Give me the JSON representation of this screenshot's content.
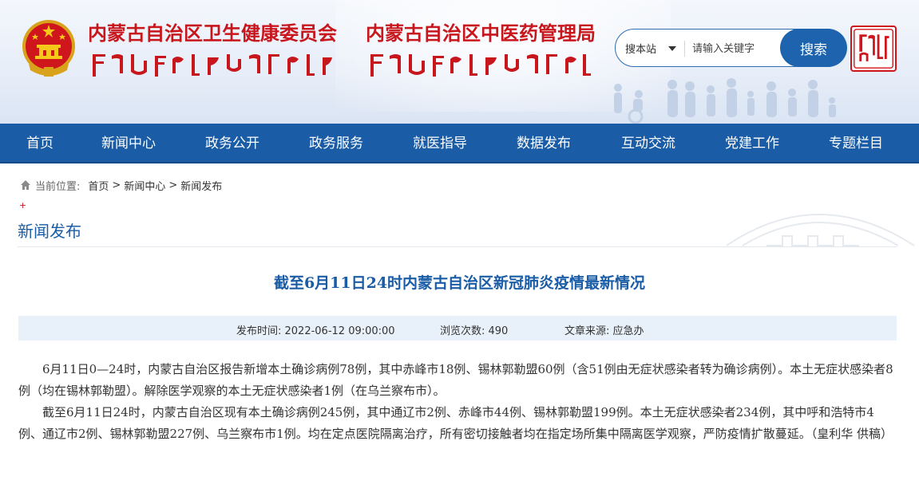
{
  "header": {
    "org1": "内蒙古自治区卫生健康委员会",
    "org2": "内蒙古自治区中医药管理局",
    "search": {
      "site_label": "搜本站",
      "placeholder": "请输入关键字",
      "button_label": "搜索"
    }
  },
  "nav": {
    "items": [
      "首页",
      "新闻中心",
      "政务公开",
      "政务服务",
      "就医指导",
      "数据发布",
      "互动交流",
      "党建工作",
      "专题栏目"
    ]
  },
  "breadcrumb": {
    "label": "当前位置:",
    "items": [
      "首页",
      "新闻中心",
      "新闻发布"
    ],
    "separator": ">"
  },
  "section": {
    "title": "新闻发布"
  },
  "article": {
    "title": "截至6月11日24时内蒙古自治区新冠肺炎疫情最新情况",
    "meta": {
      "publish_time": "发布时间:  2022-06-12 09:00:00",
      "views": "浏览次数:  490",
      "source": "文章来源:  应急办"
    },
    "paragraphs": [
      "6月11日0—24时，内蒙古自治区报告新增本土确诊病例78例，其中赤峰市18例、锡林郭勒盟60例（含51例由无症状感染者转为确诊病例）。本土无症状感染者8例（均在锡林郭勒盟）。解除医学观察的本土无症状感染者1例（在乌兰察布市）。",
      "截至6月11日24时，内蒙古自治区现有本土确诊病例245例，其中通辽市2例、赤峰市44例、锡林郭勒盟199例。本土无症状感染者234例，其中呼和浩特市4例、通辽市2例、锡林郭勒盟227例、乌兰察布市1例。均在定点医院隔离治疗，所有密切接触者均在指定场所集中隔离医学观察，严防疫情扩散蔓延。（皇利华 供稿）"
    ]
  },
  "colors": {
    "brand_blue": "#1a5ca6",
    "title_red": "#c8161d",
    "meta_bg": "#e8f1fa"
  }
}
